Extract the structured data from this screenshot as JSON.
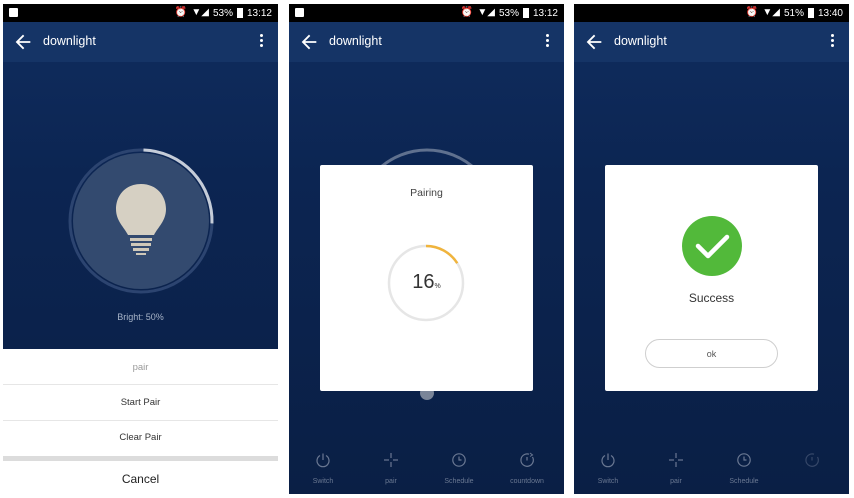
{
  "status_bars": [
    {
      "battery": "53%",
      "time": "13:12"
    },
    {
      "battery": "53%",
      "time": "13:12"
    },
    {
      "battery": "51%",
      "time": "13:40"
    }
  ],
  "app": {
    "title": "downlight"
  },
  "screen1": {
    "brightness_label": "Bright: 50%",
    "brightness_percent": 50,
    "sheet": {
      "title": "pair",
      "items": [
        "Start Pair",
        "Clear Pair"
      ],
      "cancel": "Cancel"
    }
  },
  "screen2": {
    "dialog_title": "Pairing",
    "progress_value": "16",
    "progress_unit": "%",
    "progress_percent": 16
  },
  "screen3": {
    "message": "Success",
    "ok_label": "ok"
  },
  "bottom_tabs": [
    {
      "label": "Switch",
      "icon": "power-icon"
    },
    {
      "label": "pair",
      "icon": "sparkle-icon"
    },
    {
      "label": "Schedule",
      "icon": "clock-icon"
    },
    {
      "label": "countdown",
      "icon": "timer-icon"
    }
  ],
  "colors": {
    "app_bg": "#0c2552",
    "appbar": "#153466",
    "progress_accent": "#f0b43c",
    "success_green": "#52b93a"
  }
}
